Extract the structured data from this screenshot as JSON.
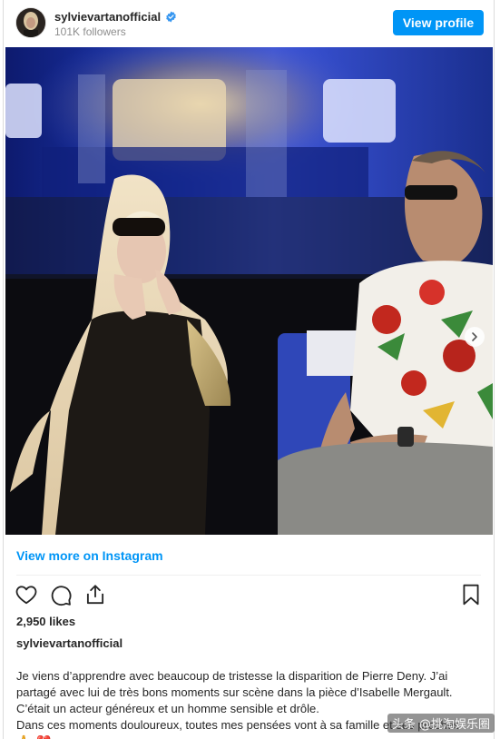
{
  "header": {
    "username": "sylvievartanofficial",
    "followers": "101K followers",
    "view_profile_label": "View profile",
    "verified_icon": "verified-badge-icon",
    "avatar_icon": "profile-avatar"
  },
  "post": {
    "photo_icon": "stage-photo",
    "carousel": {
      "count": 2,
      "active": 1
    },
    "view_more_label": "View more on Instagram",
    "likes": "2,950 likes",
    "caption_username": "sylvievartanofficial",
    "caption_lines": [
      "Je viens d’apprendre avec beaucoup de tristesse la disparition de Pierre Deny. J’ai partagé avec lui de très bons moments sur scène dans la pièce d’Isabelle Mergault. C’était un acteur généreux et un homme sensible et drôle.",
      "Dans ces moments douloureux, toutes mes pensées vont à sa famille et ses proches"
    ],
    "trailing_emojis": [
      "🙏",
      "💔"
    ]
  },
  "icons": {
    "like": "heart-icon",
    "comment": "comment-bubble-icon",
    "share": "share-icon",
    "save": "bookmark-icon",
    "next": "chevron-right-icon"
  },
  "watermark": "头条 @挑淘娱乐圈",
  "colors": {
    "accent": "#0095f6",
    "text": "#262626",
    "muted": "#8e8e8e"
  }
}
